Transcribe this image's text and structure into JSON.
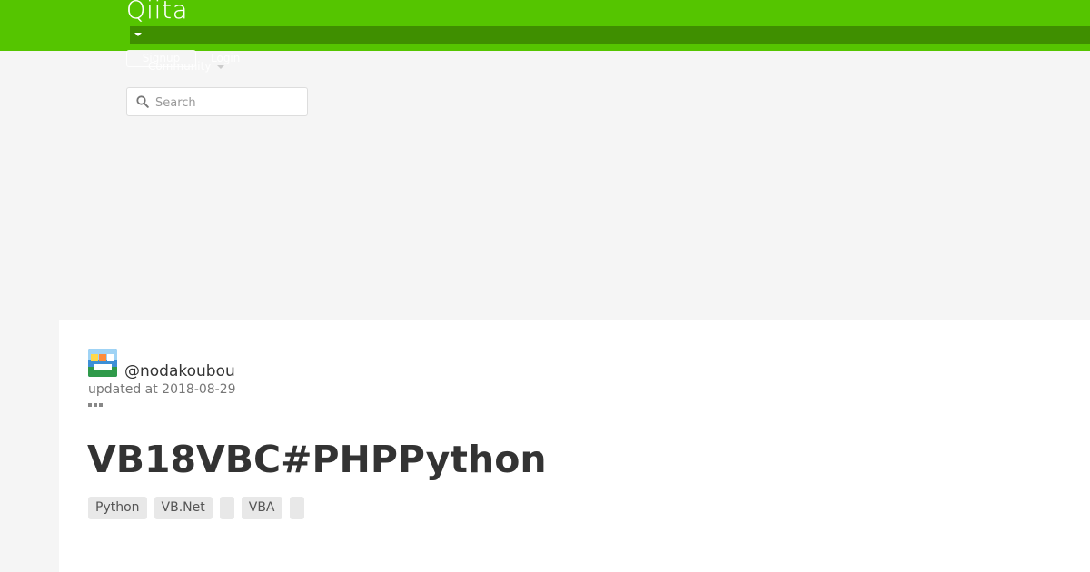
{
  "header": {
    "logo": "Qiita",
    "signup_label": "Signup",
    "login_label": "Login",
    "community_label": "Community",
    "search": {
      "placeholder": "Search"
    },
    "colors": {
      "brand": "#55c500",
      "brand_dark": "#3f8f00"
    }
  },
  "article": {
    "author": "@nodakoubou",
    "updated": "updated at 2018-08-29",
    "title": "VB18VBC#PHPPython",
    "tags": [
      {
        "label": "Python"
      },
      {
        "label": "VB.Net"
      },
      {
        "label": ""
      },
      {
        "label": "VBA"
      },
      {
        "label": ""
      }
    ]
  }
}
